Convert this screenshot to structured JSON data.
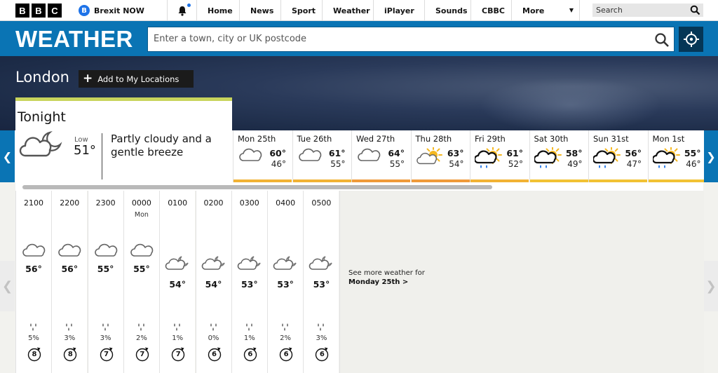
{
  "topnav": {
    "logo_letters": [
      "B",
      "B",
      "C"
    ],
    "account_initial": "B",
    "account_label": "Brexit NOW",
    "links": [
      "Home",
      "News",
      "Sport",
      "Weather",
      "iPlayer",
      "Sounds",
      "CBBC",
      "More"
    ],
    "search_placeholder": "Search",
    "notification_color": "#1e73e8"
  },
  "header": {
    "title": "WEATHER",
    "search_placeholder": "Enter a town, city or UK postcode",
    "brand_color": "#0a74b4"
  },
  "location": {
    "city": "London",
    "add_button": "Add to My Locations"
  },
  "tonight": {
    "title": "Tonight",
    "icon": "partly-cloudy-night-icon",
    "low_label": "Low",
    "low_temp": "51°",
    "description": "Partly cloudy and a gentle breeze",
    "accent_color": "#c8d45c"
  },
  "days": [
    {
      "label": "Mon 25th",
      "high": "60°",
      "low": "46°",
      "icon": "cloud-icon",
      "bar_color": "#f2b234"
    },
    {
      "label": "Tue 26th",
      "high": "61°",
      "low": "55°",
      "icon": "cloud-icon",
      "bar_color": "#f2b234"
    },
    {
      "label": "Wed 27th",
      "high": "64°",
      "low": "55°",
      "icon": "cloud-icon",
      "bar_color": "#f09a3a"
    },
    {
      "label": "Thu 28th",
      "high": "63°",
      "low": "54°",
      "icon": "sun-cloud-icon",
      "bar_color": "#f09a3a"
    },
    {
      "label": "Fri 29th",
      "high": "61°",
      "low": "52°",
      "icon": "sun-rain-icon",
      "bar_color": "#f2b234"
    },
    {
      "label": "Sat 30th",
      "high": "58°",
      "low": "49°",
      "icon": "sun-rain-icon",
      "bar_color": "#f2c234"
    },
    {
      "label": "Sun 31st",
      "high": "56°",
      "low": "47°",
      "icon": "sun-rain-icon",
      "bar_color": "#f2c234"
    },
    {
      "label": "Mon 1st",
      "high": "55°",
      "low": "46°",
      "icon": "sun-rain-icon",
      "bar_color": "#f2c234"
    }
  ],
  "hours": [
    {
      "time": "2100",
      "day": "",
      "temp": "56°",
      "icon": "cloud-icon",
      "rain": "5%",
      "wind": "8"
    },
    {
      "time": "2200",
      "day": "",
      "temp": "56°",
      "icon": "cloud-icon",
      "rain": "3%",
      "wind": "8"
    },
    {
      "time": "2300",
      "day": "",
      "temp": "55°",
      "icon": "cloud-icon",
      "rain": "3%",
      "wind": "7"
    },
    {
      "time": "0000",
      "day": "Mon",
      "temp": "55°",
      "icon": "cloud-icon",
      "rain": "2%",
      "wind": "7"
    },
    {
      "time": "0100",
      "day": "",
      "temp": "54°",
      "icon": "cloud-moon-icon",
      "rain": "1%",
      "wind": "7"
    },
    {
      "time": "0200",
      "day": "",
      "temp": "54°",
      "icon": "cloud-moon-icon",
      "rain": "0%",
      "wind": "6"
    },
    {
      "time": "0300",
      "day": "",
      "temp": "53°",
      "icon": "cloud-moon-icon",
      "rain": "1%",
      "wind": "6"
    },
    {
      "time": "0400",
      "day": "",
      "temp": "53°",
      "icon": "cloud-moon-icon",
      "rain": "2%",
      "wind": "6"
    },
    {
      "time": "0500",
      "day": "",
      "temp": "53°",
      "icon": "cloud-moon-icon",
      "rain": "3%",
      "wind": "6"
    }
  ],
  "more_weather": {
    "text": "See more weather for",
    "link": "Monday 25th >"
  }
}
